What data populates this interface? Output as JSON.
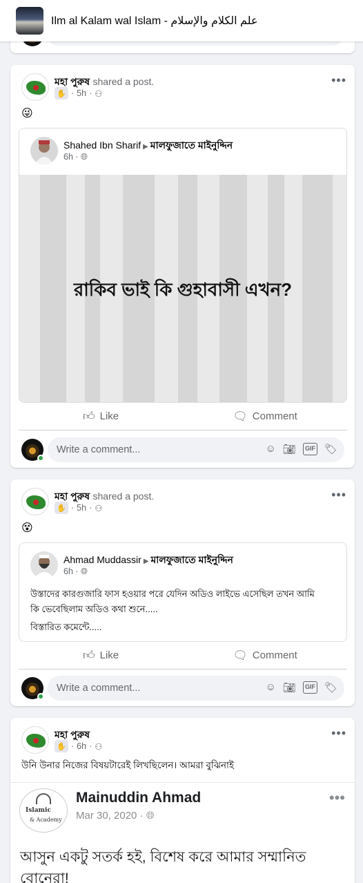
{
  "header": {
    "group_title": "Ilm al Kalam wal Islam - علم الكلام والإسلام"
  },
  "post1": {
    "author": "মহা পুরুষ",
    "action": "shared a post.",
    "time": "5h",
    "emoji": "😜",
    "shared": {
      "name": "Shahed Ibn Sharif",
      "group": "মালফুজাতে মাইনুদ্দিন",
      "time": "6h",
      "bg_text": "রাকিব ভাই কি গুহাবাসী এখন?"
    },
    "like_label": "Like",
    "comment_label": "Comment",
    "comment_placeholder": "Write a comment..."
  },
  "post2": {
    "author": "মহা পুরুষ",
    "action": "shared a post.",
    "time": "5h",
    "emoji": "😵",
    "shared": {
      "name": "Ahmad Muddassir",
      "group": "মালফুজাতে মাইনুদ্দিন",
      "time": "6h",
      "line1": "উস্তাদের কারগুজারি ফাস হওয়ার পরে যেদিন অডিও লাইভে এসেছিল তখন আমি",
      "line2": "কি ভেবেছিলাম অডিও কথা শুনে.....",
      "line3": "বিস্তারিত কমেন্টে....."
    },
    "like_label": "Like",
    "comment_label": "Comment",
    "comment_placeholder": "Write a comment..."
  },
  "post3": {
    "author": "মহা পুরুষ",
    "time": "6h",
    "text": "উনি উনার নিজের বিষয়টারেই লিখছিলেন। আমরা বুঝিনাই",
    "repost": {
      "logo_line1": "Islamic",
      "logo_line2": "& Academy",
      "name": "Mainuddin Ahmad",
      "date": "Mar 30, 2020",
      "text": "আসুন একটু সতর্ক হই, বিশেষ করে আমার সম্মানিত বোনেরা!"
    }
  },
  "gif_label": "GIF",
  "colors": {
    "accent": "#1877f2",
    "online": "#31a24c",
    "meta_gray": "#65676b"
  }
}
